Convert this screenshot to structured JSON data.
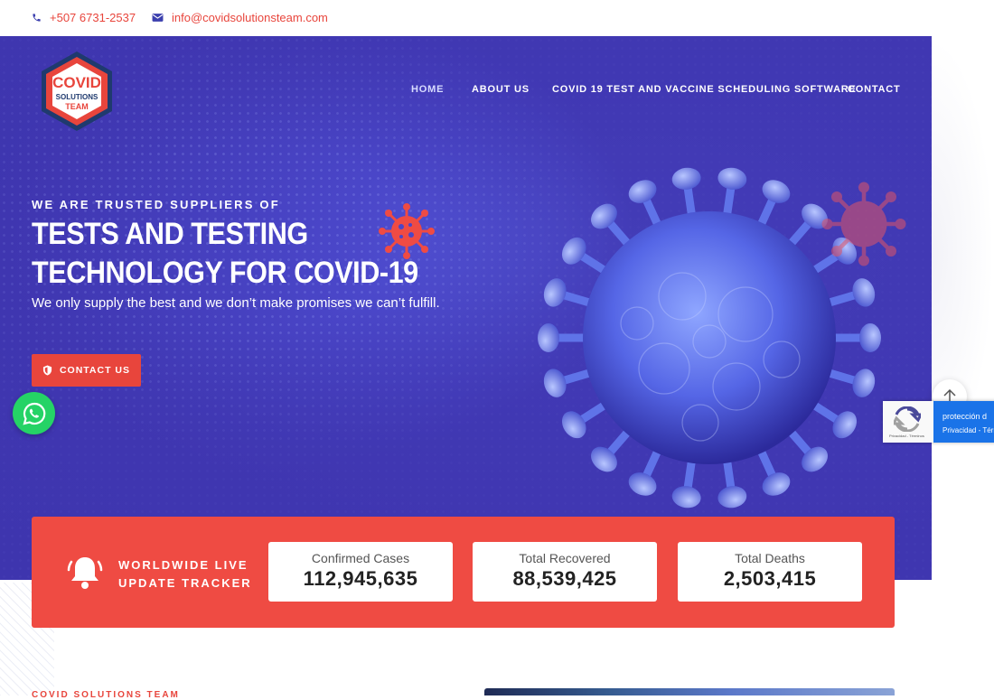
{
  "topbar": {
    "phone": "+507 6731-2537",
    "email": "info@covidsolutionsteam.com"
  },
  "logo": {
    "line1": "COVID",
    "line2": "SOLUTIONS",
    "line3": "TEAM"
  },
  "nav": {
    "items": [
      {
        "label": "HOME"
      },
      {
        "label": "ABOUT US"
      },
      {
        "label": "COVID 19 TEST AND VACCINE SCHEDULING SOFTWARE"
      },
      {
        "label": "CONTACT"
      }
    ]
  },
  "hero": {
    "kicker": "WE ARE TRUSTED SUPPLIERS OF",
    "title_line1": "TESTS AND TESTING",
    "title_line2": "TECHNOLOGY FOR COVID-19",
    "subtitle": "We only supply the best and we don’t make promises we can’t fulfill.",
    "cta_label": "CONTACT US"
  },
  "tracker": {
    "label_line1": "WORLDWIDE LIVE",
    "label_line2": "UPDATE TRACKER",
    "stats": [
      {
        "title": "Confirmed Cases",
        "value": "112,945,635"
      },
      {
        "title": "Total Recovered",
        "value": "88,539,425"
      },
      {
        "title": "Total Deaths",
        "value": "2,503,415"
      }
    ]
  },
  "recaptcha": {
    "text": "protección d",
    "links": "Privacidad - Térm",
    "small": "Privacidad - Términos"
  },
  "bottom": {
    "kicker": "COVID SOLUTIONS TEAM"
  },
  "colors": {
    "accent": "#e8453c",
    "hero_bg": "#4a46c8",
    "whatsapp": "#25d366"
  }
}
